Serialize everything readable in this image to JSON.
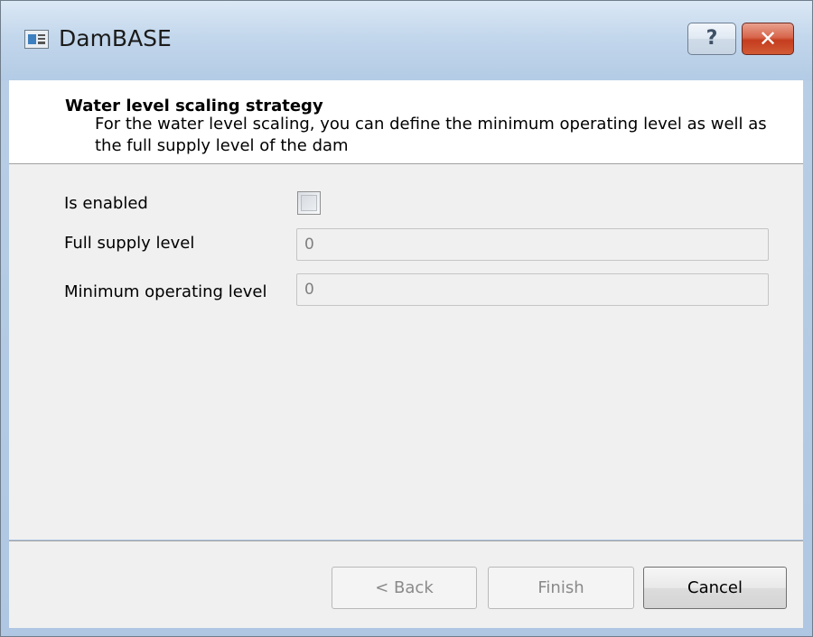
{
  "window": {
    "title": "DamBASE",
    "help_label": "?",
    "close_label": "✕"
  },
  "header": {
    "title": "Water level scaling strategy",
    "description": "For the water level scaling, you can define the minimum operating level as well as the full supply level of the dam"
  },
  "form": {
    "enabled_label": "Is enabled",
    "enabled_checked": false,
    "full_supply_label": "Full supply level",
    "full_supply_value": "0",
    "min_operating_label": "Minimum operating level",
    "min_operating_value": "0"
  },
  "buttons": {
    "back": "< Back",
    "finish": "Finish",
    "cancel": "Cancel"
  }
}
